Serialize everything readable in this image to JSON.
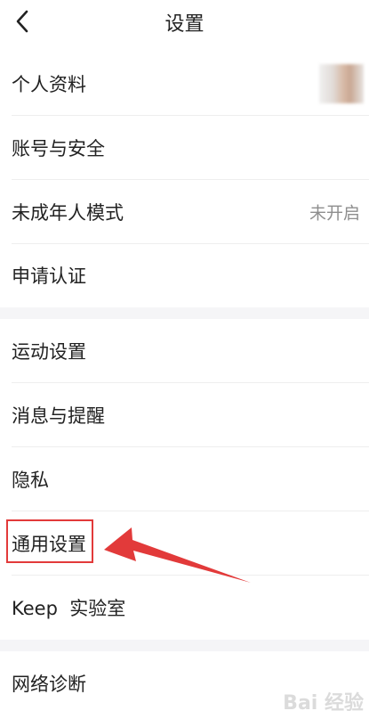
{
  "header": {
    "title": "设置"
  },
  "rows": {
    "profile": {
      "label": "个人资料"
    },
    "account_security": {
      "label": "账号与安全"
    },
    "minor_mode": {
      "label": "未成年人模式",
      "value": "未开启"
    },
    "verification": {
      "label": "申请认证"
    },
    "sport_settings": {
      "label": "运动设置"
    },
    "messages": {
      "label": "消息与提醒"
    },
    "privacy": {
      "label": "隐私"
    },
    "general_settings": {
      "label": "通用设置"
    },
    "keep_lab": {
      "label": "Keep  实验室"
    },
    "network_diag": {
      "label": "网络诊断"
    }
  },
  "annotation": {
    "highlight_color": "#e23a3a"
  },
  "watermark": {
    "text": "Bai 经验"
  },
  "colors": {
    "text": "#222222",
    "secondary_text": "#8e8e8e",
    "section_gap": "#f5f5f7",
    "divider": "#eeeeee"
  }
}
